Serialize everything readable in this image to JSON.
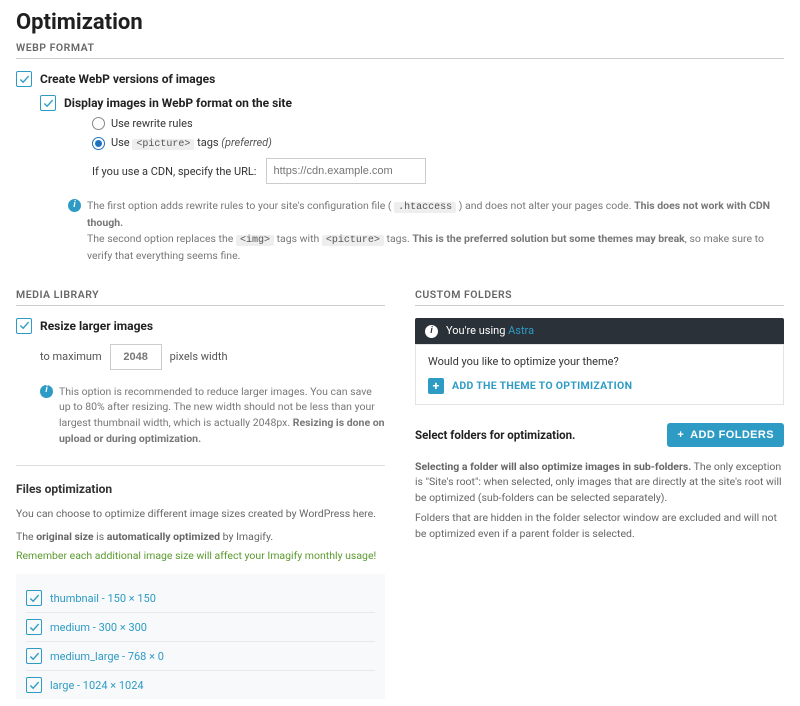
{
  "page": {
    "title": "Optimization"
  },
  "webp": {
    "header": "WEBP FORMAT",
    "create_label": "Create WebP versions of images",
    "display_label": "Display images in WebP format on the site",
    "radio_rewrite": "Use rewrite rules",
    "radio_picture_pre": "Use ",
    "radio_picture_code": "<picture>",
    "radio_picture_post": " tags ",
    "radio_picture_note": "(preferred)",
    "cdn_label": "If you use a CDN, specify the URL:",
    "cdn_placeholder": "https://cdn.example.com",
    "info1_pre": "The first option adds rewrite rules to your site's configuration file ( ",
    "info1_code": ".htaccess",
    "info1_mid": " ) and does not alter your pages code. ",
    "info1_bold": "This does not work with CDN though.",
    "info2_pre": "The second option replaces the ",
    "info2_code1": "<img>",
    "info2_mid1": " tags with ",
    "info2_code2": "<picture>",
    "info2_mid2": " tags. ",
    "info2_bold": "This is the preferred solution but some themes may break",
    "info2_post": ", so make sure to verify that everything seems fine."
  },
  "media": {
    "header": "MEDIA LIBRARY",
    "resize_label": "Resize larger images",
    "to_max": "to maximum",
    "px_value": "2048",
    "px_label": "pixels width",
    "info_pre": "This option is recommended to reduce larger images. You can save up to 80% after resizing. The new width should not be less than your largest thumbnail width, which is actually 2048px. ",
    "info_bold": "Resizing is done on upload or during optimization."
  },
  "custom": {
    "header": "CUSTOM FOLDERS",
    "using_pre": "You're using ",
    "theme_name": "Astra",
    "theme_q": "Would you like to optimize your theme?",
    "add_theme": "ADD THE THEME TO OPTIMIZATION",
    "select_label": "Select folders for optimization.",
    "add_folders": "ADD FOLDERS",
    "para1_bold": "Selecting a folder will also optimize images in sub-folders.",
    "para1_rest": " The only exception is \"Site's root\": when selected, only images that are directly at the site's root will be optimized (sub-folders can be selected separately).",
    "para2": "Folders that are hidden in the folder selector window are excluded and will not be optimized even if a parent folder is selected."
  },
  "files": {
    "title": "Files optimization",
    "line1": "You can choose to optimize different image sizes created by WordPress here.",
    "line2_pre": "The ",
    "line2_b1": "original size",
    "line2_mid": " is ",
    "line2_b2": "automatically optimized",
    "line2_post": " by Imagify.",
    "line3": "Remember each additional image size will affect your Imagify monthly usage!",
    "sizes": [
      "thumbnail - 150 × 150",
      "medium - 300 × 300",
      "medium_large - 768 × 0",
      "large - 1024 × 1024"
    ]
  }
}
